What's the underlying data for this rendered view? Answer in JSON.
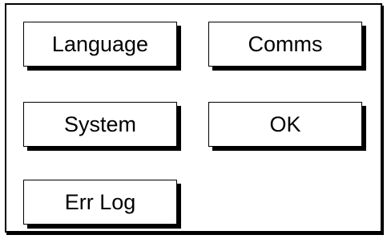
{
  "menu": {
    "language_label": "Language",
    "comms_label": "Comms",
    "system_label": "System",
    "ok_label": "OK",
    "err_log_label": "Err Log"
  }
}
